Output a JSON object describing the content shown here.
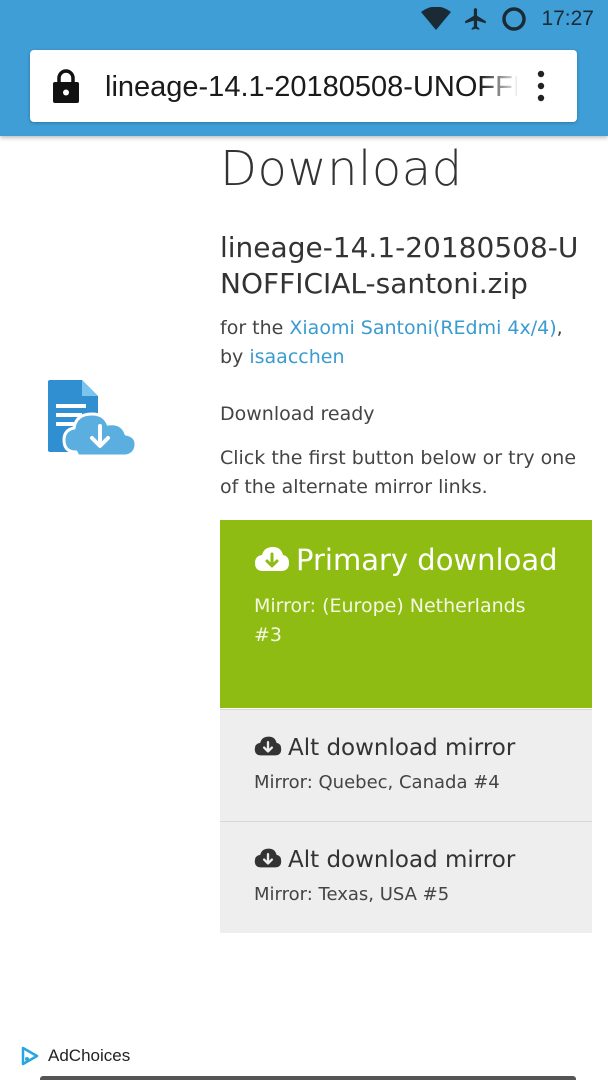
{
  "status_bar": {
    "time": "17:27"
  },
  "browser": {
    "url": "lineage-14.1-20180508-UNOFFICIAL-santoni.zip"
  },
  "page": {
    "title": "Download",
    "file_name": "lineage-14.1-20180508-UNOFFICIAL-santoni.zip",
    "for_prefix": "for the ",
    "device_link": "Xiaomi Santoni(REdmi 4x/4)",
    "by_text": ", by ",
    "author_link": "isaacchen",
    "ready": "Download ready",
    "instructions": "Click the first button below or try one of the alternate mirror links."
  },
  "downloads": {
    "primary": {
      "label": "Primary download",
      "mirror": "Mirror: (Europe) Netherlands #3"
    },
    "alt": [
      {
        "label": "Alt download mirror",
        "mirror": "Mirror: Quebec, Canada #4"
      },
      {
        "label": "Alt download mirror",
        "mirror": "Mirror: Texas, USA #5"
      }
    ]
  },
  "ads": {
    "label": "AdChoices"
  },
  "colors": {
    "chrome": "#3f9ed6",
    "primary_button": "#8fbc12",
    "alt_button": "#eeeeee",
    "link": "#3a9bd0"
  },
  "icons": [
    "wifi-icon",
    "airplane-icon",
    "do-not-disturb-icon",
    "lock-icon",
    "overflow-menu-icon",
    "file-download-icon",
    "cloud-download-icon",
    "adchoices-icon"
  ]
}
